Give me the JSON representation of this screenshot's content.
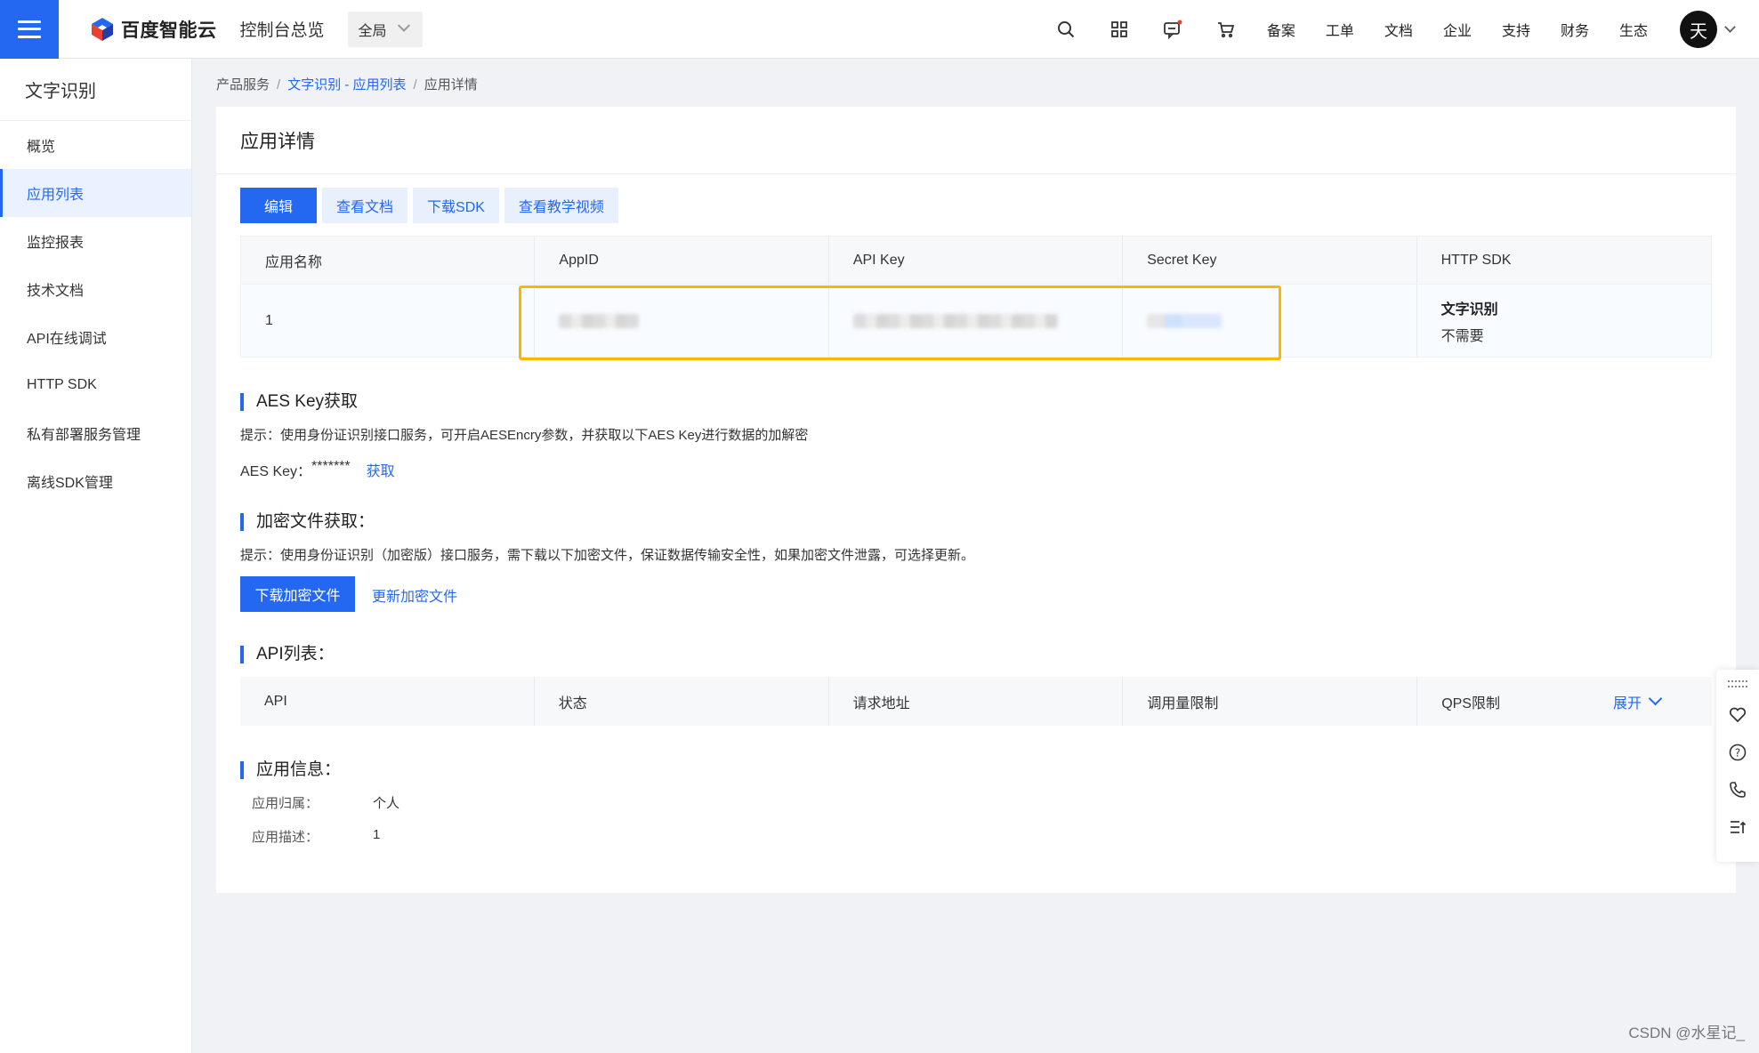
{
  "topbar": {
    "logo_text": "百度智能云",
    "console_title": "控制台总览",
    "region": "全局",
    "icons": [
      "search-icon",
      "apps-grid-icon",
      "message-icon",
      "cart-icon"
    ],
    "links": [
      "备案",
      "工单",
      "文档",
      "企业",
      "支持",
      "财务",
      "生态"
    ],
    "avatar_initial": "天",
    "accent_color": "#2468f2"
  },
  "sidebar": {
    "title": "文字识别",
    "items": [
      {
        "label": "概览"
      },
      {
        "label": "应用列表"
      },
      {
        "label": "监控报表"
      },
      {
        "label": "技术文档"
      },
      {
        "label": "API在线调试"
      },
      {
        "label": "HTTP SDK"
      },
      {
        "label": "私有部署服务管理"
      },
      {
        "label": "离线SDK管理"
      }
    ],
    "active_index": 1
  },
  "breadcrumb": {
    "root": "产品服务",
    "link": "文字识别 - 应用列表",
    "current": "应用详情"
  },
  "detail": {
    "title": "应用详情",
    "buttons": {
      "edit": "编辑",
      "docs": "查看文档",
      "sdk": "下载SDK",
      "video": "查看教学视频"
    },
    "table": {
      "headers": [
        "应用名称",
        "AppID",
        "API Key",
        "Secret Key",
        "HTTP SDK"
      ],
      "row": {
        "name": "1",
        "sdk_name": "文字识别",
        "sdk_sub": "不需要"
      }
    },
    "highlight_color": "#f8b700"
  },
  "aes": {
    "title": "AES Key获取",
    "hint": "提示：使用身份证识别接口服务，可开启AESEncry参数，并获取以下AES Key进行数据的加解密",
    "label": "AES Key：",
    "value": "*******",
    "action": "获取"
  },
  "encrypt": {
    "title": "加密文件获取：",
    "hint": "提示：使用身份证识别（加密版）接口服务，需下载以下加密文件，保证数据传输安全性，如果加密文件泄露，可选择更新。",
    "download": "下载加密文件",
    "update": "更新加密文件"
  },
  "api_list": {
    "title": "API列表：",
    "headers": [
      "API",
      "状态",
      "请求地址",
      "调用量限制",
      "QPS限制"
    ],
    "expand": "展开"
  },
  "app_info": {
    "title": "应用信息：",
    "owner_label": "应用归属：",
    "owner_value": "个人",
    "desc_label": "应用描述：",
    "desc_value": "1"
  },
  "float_tools": [
    "drag-handle-icon",
    "heart-icon",
    "help-icon",
    "phone-icon",
    "scroll-top-icon"
  ],
  "watermark": "CSDN @水星记_"
}
